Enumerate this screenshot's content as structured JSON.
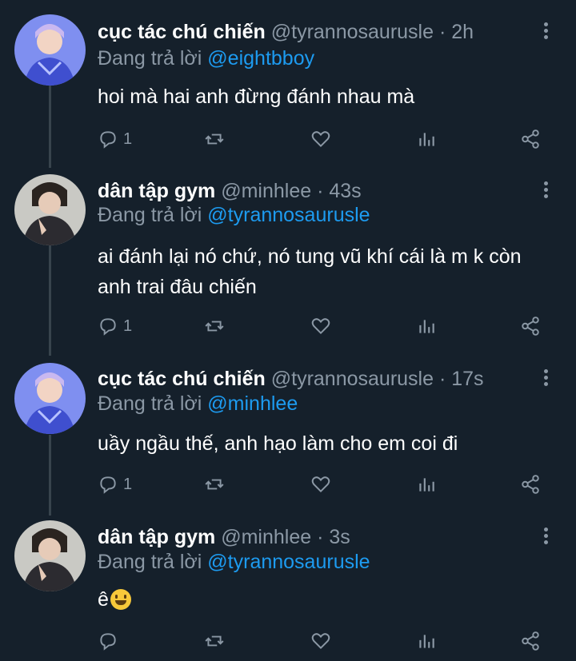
{
  "tweets": [
    {
      "name": "cục tác chú chiến",
      "handle": "@tyrannosaurusle",
      "dot": "·",
      "time": "2h",
      "reply_prefix": "Đang trả lời",
      "reply_to": "@eightbboy",
      "text": "hoi mà hai anh đừng đánh nhau mà",
      "reply_count": "1",
      "avatar": "avatar-blue-portrait"
    },
    {
      "name": "dân tập gym",
      "handle": "@minhlee",
      "dot": "·",
      "time": "43s",
      "reply_prefix": "Đang trả lời",
      "reply_to": "@tyrannosaurusle",
      "text": "ai đánh lại nó chứ, nó tung vũ khí cái là m k còn anh trai đâu chiến",
      "reply_count": "1",
      "avatar": "avatar-dark-portrait"
    },
    {
      "name": "cục tác chú chiến",
      "handle": "@tyrannosaurusle",
      "dot": "·",
      "time": "17s",
      "reply_prefix": "Đang trả lời",
      "reply_to": "@minhlee",
      "text": "uầy ngầu thế, anh hạo làm cho em coi đi",
      "reply_count": "1",
      "avatar": "avatar-blue-portrait"
    },
    {
      "name": "dân tập gym",
      "handle": "@minhlee",
      "dot": "·",
      "time": "3s",
      "reply_prefix": "Đang trả lời",
      "reply_to": "@tyrannosaurusle",
      "text": "ê",
      "reply_count": "",
      "avatar": "avatar-dark-portrait"
    }
  ],
  "icons": {
    "reply": "reply-icon",
    "retweet": "retweet-icon",
    "like": "heart-icon",
    "analytics": "analytics-icon",
    "share": "share-icon",
    "more": "more-vertical-icon",
    "emoji": "grinning-face-emoji"
  },
  "colors": {
    "background": "#15202b",
    "text": "#ffffff",
    "muted": "#8b98a5",
    "mention": "#1d9bf0",
    "thread_line": "#38444d"
  }
}
